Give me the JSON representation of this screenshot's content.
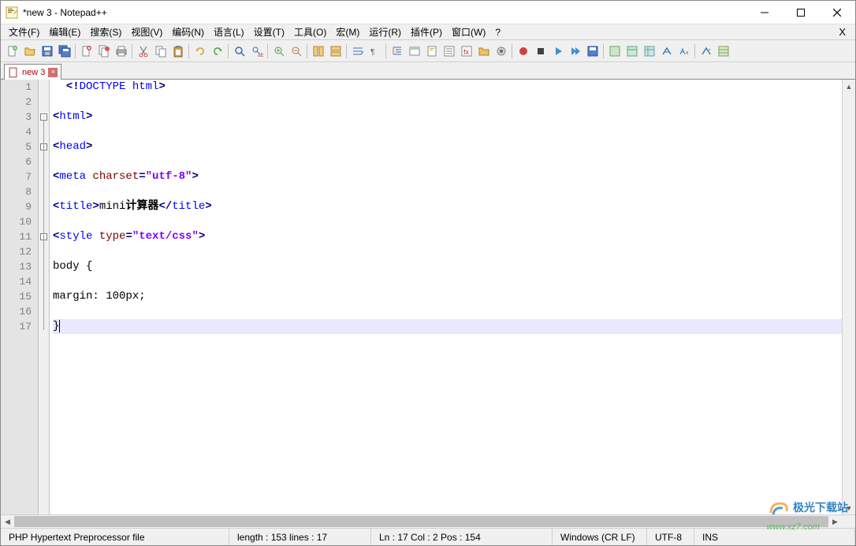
{
  "window": {
    "title": "*new 3 - Notepad++"
  },
  "menus": [
    "文件(F)",
    "编辑(E)",
    "搜索(S)",
    "视图(V)",
    "编码(N)",
    "语言(L)",
    "设置(T)",
    "工具(O)",
    "宏(M)",
    "运行(R)",
    "插件(P)",
    "窗口(W)",
    "?"
  ],
  "menu_close_x": "X",
  "tab": {
    "label": "new 3",
    "close_x": "×"
  },
  "code_lines": [
    {
      "n": 1,
      "html": "  <span class='punct'>&lt;!</span><span class='kw-blue'>DOCTYPE</span> <span class='kw-blue'>html</span><span class='punct'>&gt;</span>"
    },
    {
      "n": 2,
      "html": ""
    },
    {
      "n": 3,
      "html": "<span class='punct'>&lt;</span><span class='kw-blue'>html</span><span class='punct'>&gt;</span>",
      "fold": "open"
    },
    {
      "n": 4,
      "html": ""
    },
    {
      "n": 5,
      "html": "<span class='punct'>&lt;</span><span class='kw-blue'>head</span><span class='punct'>&gt;</span>",
      "fold": "open"
    },
    {
      "n": 6,
      "html": ""
    },
    {
      "n": 7,
      "html": "<span class='punct'>&lt;</span><span class='kw-blue'>meta</span> <span class='kw-red'>charset</span><span class='punct'>=</span><span class='str-purple'>&quot;utf-8&quot;</span><span class='punct'>&gt;</span>"
    },
    {
      "n": 8,
      "html": ""
    },
    {
      "n": 9,
      "html": "<span class='punct'>&lt;</span><span class='kw-blue'>title</span><span class='punct'>&gt;</span><span class='text-black'>mini<b>计算器</b></span><span class='punct'>&lt;/</span><span class='kw-blue'>title</span><span class='punct'>&gt;</span>"
    },
    {
      "n": 10,
      "html": ""
    },
    {
      "n": 11,
      "html": "<span class='punct'>&lt;</span><span class='kw-blue'>style</span> <span class='kw-red'>type</span><span class='punct'>=</span><span class='str-purple'>&quot;text/css&quot;</span><span class='punct'>&gt;</span>",
      "fold": "open"
    },
    {
      "n": 12,
      "html": ""
    },
    {
      "n": 13,
      "html": "<span class='text-black'>body {</span>"
    },
    {
      "n": 14,
      "html": ""
    },
    {
      "n": 15,
      "html": "<span class='text-black'>margin: 100px;</span>"
    },
    {
      "n": 16,
      "html": ""
    },
    {
      "n": 17,
      "html": "<span class='text-black'>}</span>",
      "current": true
    }
  ],
  "status": {
    "file_type": "PHP Hypertext Preprocessor file",
    "length_lines": "length : 153    lines : 17",
    "pos": "Ln : 17    Col : 2    Pos : 154",
    "eol": "Windows (CR LF)",
    "encoding": "UTF-8",
    "ins": "INS"
  },
  "watermark": {
    "text": "极光下载站",
    "url": "www.xz7.com"
  }
}
